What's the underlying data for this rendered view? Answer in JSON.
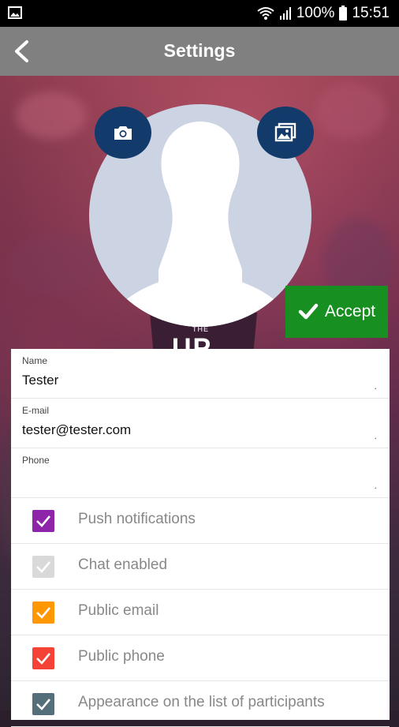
{
  "status_bar": {
    "battery": "100%",
    "time": "15:51"
  },
  "app_bar": {
    "title": "Settings"
  },
  "hero": {
    "banner_small": "THE",
    "banner_large": "UP"
  },
  "accept_button": {
    "label": "Accept"
  },
  "form": {
    "name": {
      "label": "Name",
      "value": "Tester",
      "dot": "."
    },
    "email": {
      "label": "E-mail",
      "value": "tester@tester.com",
      "dot": "."
    },
    "phone": {
      "label": "Phone",
      "value": "",
      "dot": "."
    }
  },
  "checkboxes": [
    {
      "label": "Push notifications",
      "color": "#8e24aa",
      "checked": true
    },
    {
      "label": "Chat enabled",
      "color": "#d9d9d9",
      "checked": true
    },
    {
      "label": "Public email",
      "color": "#ff9800",
      "checked": true
    },
    {
      "label": "Public phone",
      "color": "#f44336",
      "checked": true
    },
    {
      "label": "Appearance on the list of participants",
      "color": "#546e7a",
      "checked": true
    }
  ],
  "icons": {
    "back": "back-arrow-icon",
    "camera": "camera-icon",
    "gallery": "gallery-icon",
    "check": "check-icon"
  }
}
